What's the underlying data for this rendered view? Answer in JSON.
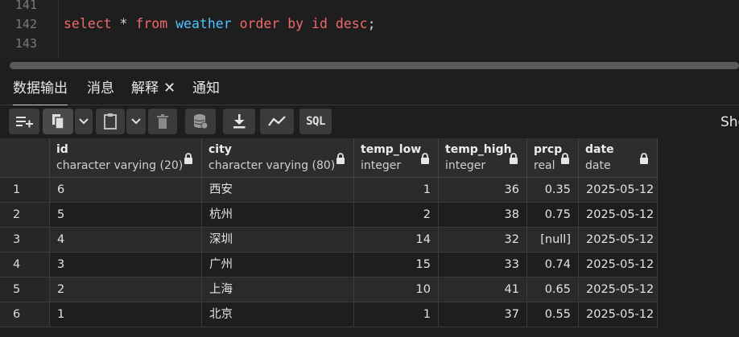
{
  "editor": {
    "lines": [
      {
        "number": "141",
        "code": ""
      },
      {
        "number": "142",
        "code": "select * from weather order by id desc;"
      },
      {
        "number": "143",
        "code": ""
      }
    ],
    "sql_tokens": {
      "select": "select",
      "star": "*",
      "from": "from",
      "table": "weather",
      "order": "order",
      "by": "by",
      "col": "id",
      "desc": "desc",
      "end": ";"
    }
  },
  "tabs": [
    {
      "label": "数据输出",
      "active": true
    },
    {
      "label": "消息",
      "active": false
    },
    {
      "label": "解释",
      "active": false,
      "closable": true
    },
    {
      "label": "通知",
      "active": false
    }
  ],
  "tab_close_glyph": "✕",
  "toolbar": {
    "sql_label": "SQL",
    "truncated_label": "Sho"
  },
  "grid": {
    "columns": [
      {
        "name": "",
        "type": ""
      },
      {
        "name": "id",
        "type": "character varying (20)"
      },
      {
        "name": "city",
        "type": "character varying (80)"
      },
      {
        "name": "temp_low",
        "type": "integer"
      },
      {
        "name": "temp_high",
        "type": "integer"
      },
      {
        "name": "prcp",
        "type": "real"
      },
      {
        "name": "date",
        "type": "date"
      }
    ],
    "rows": [
      [
        "1",
        "6",
        "西安",
        "1",
        "36",
        "0.35",
        "2025-05-12"
      ],
      [
        "2",
        "5",
        "杭州",
        "2",
        "38",
        "0.75",
        "2025-05-12"
      ],
      [
        "3",
        "4",
        "深圳",
        "14",
        "32",
        "[null]",
        "2025-05-12"
      ],
      [
        "4",
        "3",
        "广州",
        "15",
        "33",
        "0.74",
        "2025-05-12"
      ],
      [
        "5",
        "2",
        "上海",
        "10",
        "41",
        "0.65",
        "2025-05-12"
      ],
      [
        "6",
        "1",
        "北京",
        "1",
        "37",
        "0.55",
        "2025-05-12"
      ]
    ]
  },
  "colors": {
    "editor_bg": "#1e1e1e",
    "keyword": "#f06a6a",
    "identifier": "#4fc1ff",
    "header_bg": "#2d2d2d",
    "even_row_bg": "#2a2a2a",
    "odd_row_bg": "#1e1e1e",
    "toolbar_button": "#3b3b3b"
  }
}
